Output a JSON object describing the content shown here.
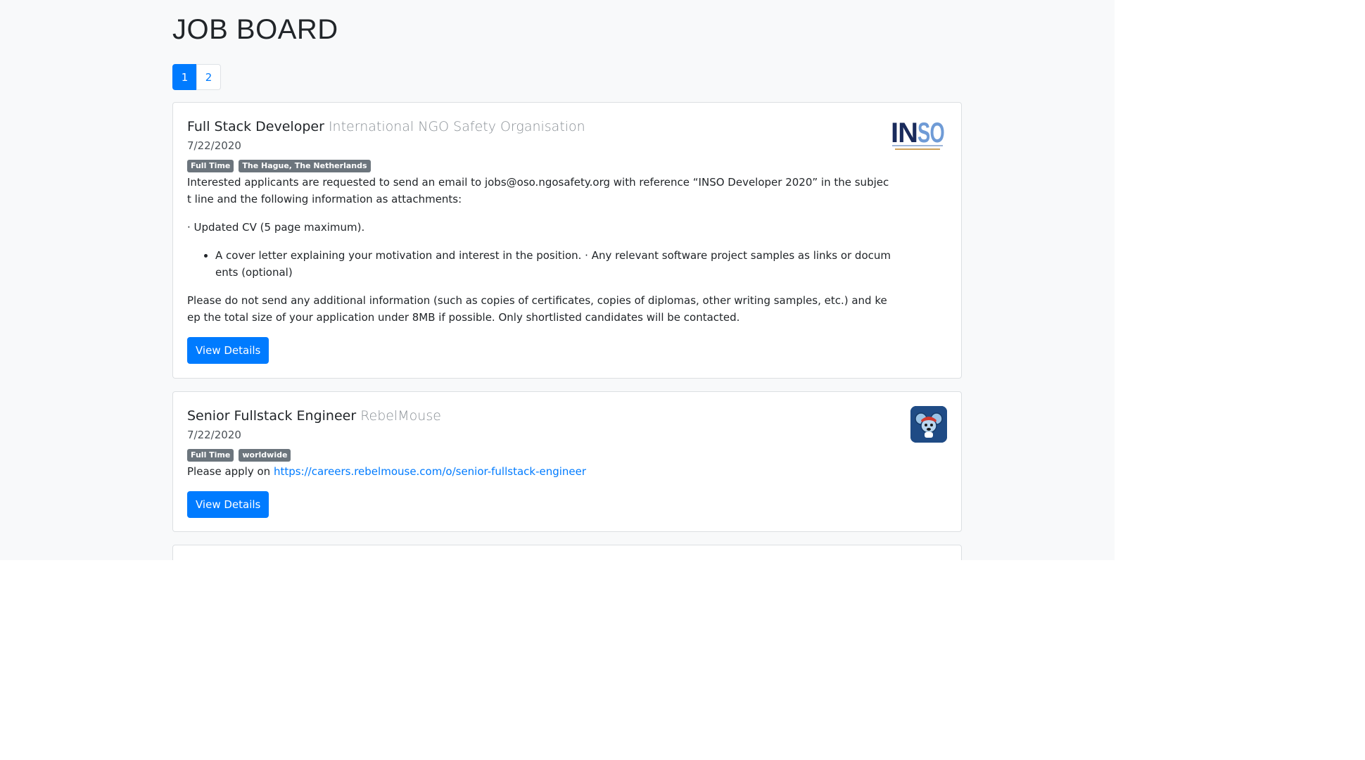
{
  "page": {
    "title": "JOB BOARD"
  },
  "pagination": {
    "pages": [
      "1",
      "2"
    ],
    "active": "1"
  },
  "jobs": [
    {
      "title": "Full Stack Developer",
      "company": "International NGO Safety Organisation",
      "date": "7/22/2020",
      "badges": [
        "Full Time",
        "The Hague, The Netherlands"
      ],
      "logo": {
        "icon": "inso-logo",
        "text": "INSO",
        "subtext": "International NGO Safety Organisation"
      },
      "description": {
        "p1": "Interested applicants are requested to send an email to jobs@oso.ngosafety.org with reference “INSO Developer 2020” in the subject line and the following information as attachments:",
        "p2": "· Updated CV (5 page maximum).",
        "li1": "A cover letter explaining your motivation and interest in the position. · Any relevant software project samples as links or documents (optional)",
        "p3": "Please do not send any additional information (such as copies of certificates, copies of diplomas, other writing samples, etc.) and keep the total size of your application under 8MB if possible. Only shortlisted candidates will be contacted."
      },
      "button": "View Details"
    },
    {
      "title": "Senior Fullstack Engineer",
      "company": "RebelMouse",
      "date": "7/22/2020",
      "badges": [
        "Full Time",
        "worldwide"
      ],
      "logo": {
        "icon": "rebelmouse-logo"
      },
      "description": {
        "prefix": "Please apply on",
        "link": "https://careers.rebelmouse.com/o/senior-fullstack-engineer"
      },
      "button": "View Details"
    }
  ],
  "colors": {
    "primary": "#007bff",
    "badge": "#6c757d",
    "background": "#f8f9fa"
  }
}
